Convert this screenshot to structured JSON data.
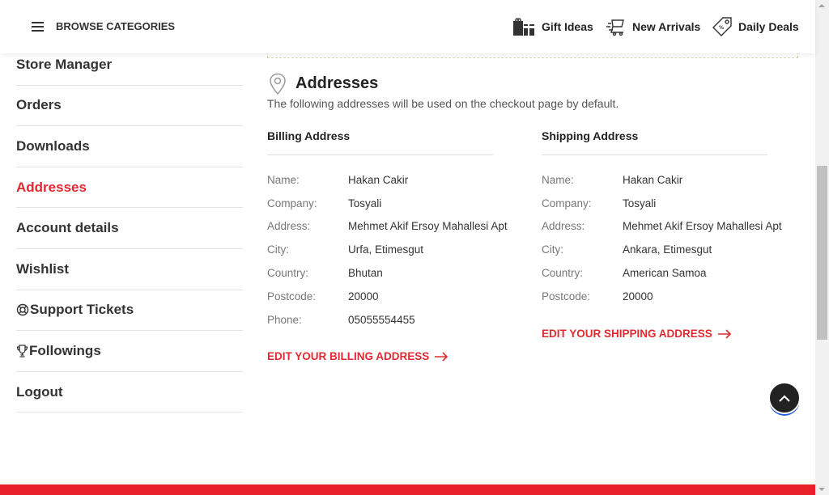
{
  "header": {
    "browse_label": "BROWSE CATEGORIES",
    "links": [
      {
        "label": "Gift Ideas",
        "icon": "gift-icon"
      },
      {
        "label": "New Arrivals",
        "icon": "new-arrivals-icon"
      },
      {
        "label": "Daily Deals",
        "icon": "tag-icon"
      }
    ]
  },
  "sidebar": {
    "items": [
      {
        "label": "Store Manager"
      },
      {
        "label": "Orders"
      },
      {
        "label": "Downloads"
      },
      {
        "label": "Addresses",
        "active": true
      },
      {
        "label": "Account details"
      },
      {
        "label": "Wishlist"
      },
      {
        "label": "Support Tickets",
        "icon": "lifebuoy-icon"
      },
      {
        "label": "Followings",
        "icon": "trophy-icon"
      },
      {
        "label": "Logout"
      }
    ]
  },
  "main": {
    "title": "Addresses",
    "intro": "The following addresses will be used on the checkout page by default.",
    "billing": {
      "title": "Billing Address",
      "rows": [
        {
          "label": "Name:",
          "value": "Hakan Cakir"
        },
        {
          "label": "Company:",
          "value": "Tosyali"
        },
        {
          "label": "Address:",
          "value": "Mehmet Akif Ersoy Mahallesi Apt"
        },
        {
          "label": "City:",
          "value": "Urfa, Etimesgut"
        },
        {
          "label": "Country:",
          "value": "Bhutan"
        },
        {
          "label": "Postcode:",
          "value": "20000"
        },
        {
          "label": "Phone:",
          "value": "05055554455"
        }
      ],
      "edit_label": "EDIT YOUR BILLING ADDRESS"
    },
    "shipping": {
      "title": "Shipping Address",
      "rows": [
        {
          "label": "Name:",
          "value": "Hakan Cakir"
        },
        {
          "label": "Company:",
          "value": "Tosyali"
        },
        {
          "label": "Address:",
          "value": "Mehmet Akif Ersoy Mahallesi Apt"
        },
        {
          "label": "City:",
          "value": "Ankara, Etimesgut"
        },
        {
          "label": "Country:",
          "value": "American Samoa"
        },
        {
          "label": "Postcode:",
          "value": "20000"
        }
      ],
      "edit_label": "EDIT YOUR SHIPPING ADDRESS"
    }
  },
  "colors": {
    "accent": "#e02a31",
    "footer": "#e8202a",
    "scroll_button": "#222222"
  }
}
